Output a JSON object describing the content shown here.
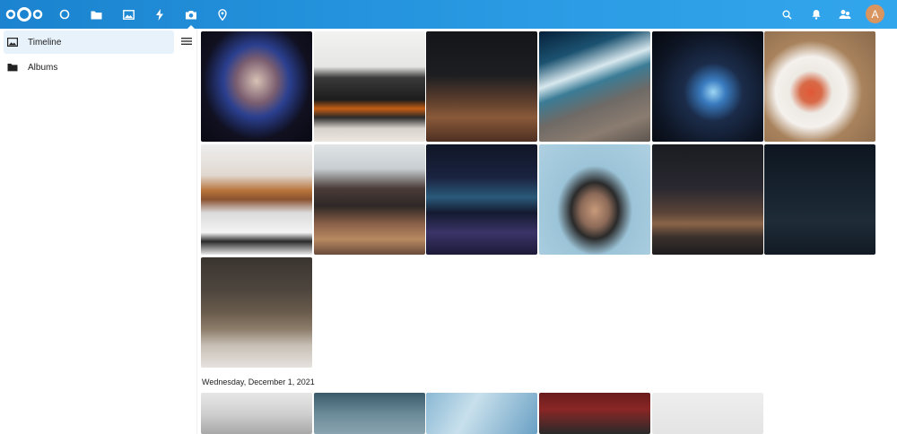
{
  "header": {
    "apps": [
      {
        "name": "dashboard-app",
        "icon": "circle-icon"
      },
      {
        "name": "files-app",
        "icon": "folder-icon"
      },
      {
        "name": "photos-app",
        "icon": "image-icon"
      },
      {
        "name": "activity-app",
        "icon": "lightning-icon"
      },
      {
        "name": "photos-camera-app",
        "icon": "camera-icon",
        "active": true
      },
      {
        "name": "maps-app",
        "icon": "location-pin-icon"
      }
    ],
    "right_icons": [
      "search-icon",
      "bell-icon",
      "contacts-icon"
    ],
    "avatar_letter": "A"
  },
  "sidebar": {
    "items": [
      {
        "label": "Timeline",
        "icon": "image-icon",
        "active": true
      },
      {
        "label": "Albums",
        "icon": "folder-icon",
        "active": false
      }
    ]
  },
  "sections": [
    {
      "date": ""
    },
    {
      "date": "Wednesday, December 1, 2021"
    }
  ],
  "colors": {
    "header_start": "#1b83cf",
    "header_end": "#32a6ec",
    "active_nav": "#e8f2fb",
    "avatar": "#d99560"
  }
}
